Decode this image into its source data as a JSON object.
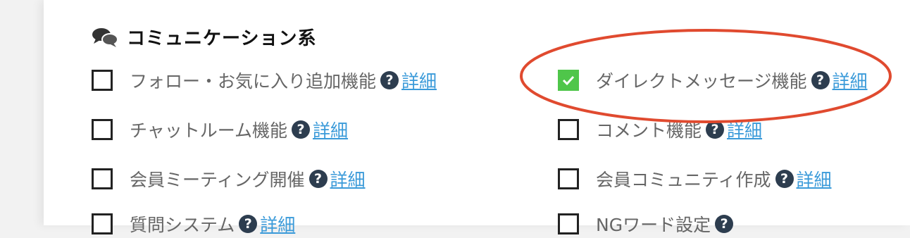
{
  "section": {
    "title": "コミュニケーション系",
    "icon": "chat-bubbles-icon"
  },
  "help_glyph": "?",
  "options": [
    {
      "id": "follow",
      "label": "フォロー・お気に入り追加機能",
      "checked": false,
      "detail": "詳細"
    },
    {
      "id": "dm",
      "label": "ダイレクトメッセージ機能",
      "checked": true,
      "detail": "詳細"
    },
    {
      "id": "chatroom",
      "label": "チャットルーム機能",
      "checked": false,
      "detail": "詳細"
    },
    {
      "id": "comment",
      "label": "コメント機能",
      "checked": false,
      "detail": "詳細"
    },
    {
      "id": "meeting",
      "label": "会員ミーティング開催",
      "checked": false,
      "detail": "詳細"
    },
    {
      "id": "community",
      "label": "会員コミュニティ作成",
      "checked": false,
      "detail": "詳細"
    },
    {
      "id": "question",
      "label": "質問システム",
      "checked": false,
      "detail": "詳細"
    },
    {
      "id": "ngword",
      "label": "NGワード設定",
      "checked": false,
      "detail": ""
    }
  ],
  "colors": {
    "checked": "#4fc64a",
    "link": "#3a9ad9",
    "annotation": "#e04a2f",
    "help_icon": "#2d3d4f"
  }
}
